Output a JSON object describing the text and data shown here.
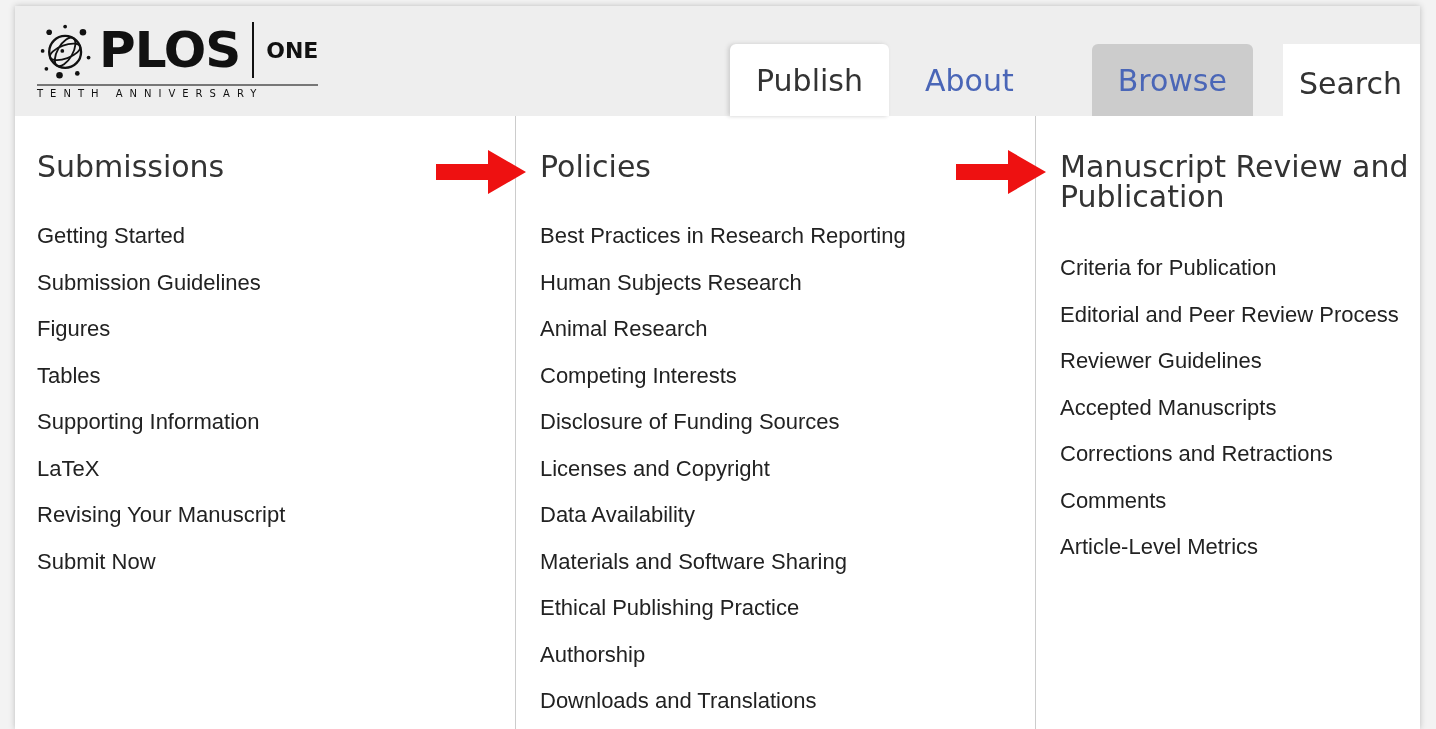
{
  "logo": {
    "name": "PLOS",
    "journal": "ONE",
    "tagline": "TENTH ANNIVERSARY"
  },
  "tabs": [
    {
      "label": "Publish",
      "selected": true,
      "hovered": false
    },
    {
      "label": "About",
      "selected": false,
      "hovered": false
    },
    {
      "label": "Browse",
      "selected": false,
      "hovered": true
    }
  ],
  "search": {
    "label": "Search"
  },
  "columns": [
    {
      "heading": "Submissions",
      "marked": false,
      "items": [
        "Getting Started",
        "Submission Guidelines",
        "Figures",
        "Tables",
        "Supporting Information",
        "LaTeX",
        "Revising Your Manuscript",
        "Submit Now"
      ]
    },
    {
      "heading": "Policies",
      "marked": true,
      "items": [
        "Best Practices in Research Reporting",
        "Human Subjects Research",
        "Animal Research",
        "Competing Interests",
        "Disclosure of Funding Sources",
        "Licenses and Copyright",
        "Data Availability",
        "Materials and Software Sharing",
        "Ethical Publishing Practice",
        "Authorship",
        "Downloads and Translations"
      ]
    },
    {
      "heading": "Manuscript Review and Publication",
      "marked": true,
      "items": [
        "Criteria for Publication",
        "Editorial and Peer Review Process",
        "Reviewer Guidelines",
        "Accepted Manuscripts",
        "Corrections and Retractions",
        "Comments",
        "Article-Level Metrics"
      ]
    }
  ]
}
